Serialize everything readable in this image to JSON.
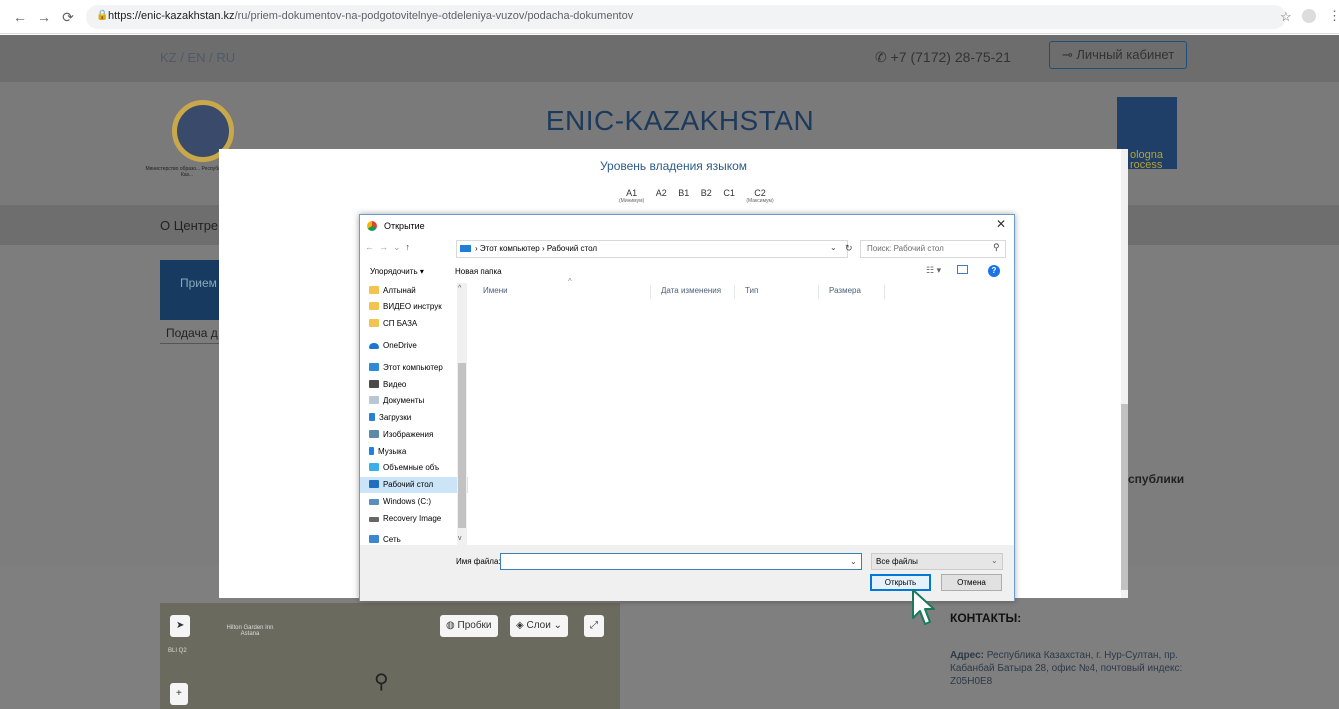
{
  "browser": {
    "url_host": "https://enic-kazakhstan.kz",
    "url_path": "/ru/priem-dokumentov-na-podgotovitelnye-otdeleniya-vuzov/podacha-dokumentov"
  },
  "site": {
    "languages": "KZ / EN / RU",
    "phone": "+7 (7172) 28-75-21",
    "cabinet_button": "Личный кабинет",
    "title": "ENIC-KAZAKHSTAN",
    "bologna_text": "ologna\nrocess",
    "logo_caption": "Министерство образо... Республики Каз...",
    "menu_about": "О Центре",
    "tab_priem": "Прием",
    "tab_podacha": "Подача д",
    "right_text": "спублики",
    "contacts_title": "КОНТАКТЫ:",
    "contacts_address_label": "Адрес:",
    "contacts_address": "Республика Казахстан, г. Нур-Султан, пр. Кабанбай Батыра 28, офис №4, почтовый индекс: Z05H0E8",
    "map": {
      "traffic": "Пробки",
      "layers": "Слои",
      "place": "Hilton Garden Inn Astana",
      "label_left": "BLI Q2"
    }
  },
  "modal": {
    "heading": "Уровень владения языком",
    "levels": [
      {
        "code": "A1",
        "note": "(Минимум)"
      },
      {
        "code": "A2",
        "note": ""
      },
      {
        "code": "B1",
        "note": ""
      },
      {
        "code": "B2",
        "note": ""
      },
      {
        "code": "C1",
        "note": ""
      },
      {
        "code": "C2",
        "note": "(Максимум)"
      }
    ]
  },
  "dialog": {
    "title": "Открытие",
    "path": [
      "Этот компьютер",
      "Рабочий стол"
    ],
    "search_placeholder": "Поиск: Рабочий стол",
    "organize": "Упорядочить ▾",
    "new_folder": "Новая папка",
    "nav_items": [
      {
        "label": "Алтынай",
        "icon": "folder-icon",
        "kind": "folder"
      },
      {
        "label": "ВИДЕО инструк",
        "icon": "folder-icon",
        "kind": "folder"
      },
      {
        "label": "СП БАЗА",
        "icon": "folder-icon",
        "kind": "folder"
      },
      {
        "label": "OneDrive",
        "icon": "onedrive-icon",
        "kind": "cloud"
      },
      {
        "label": "Этот компьютер",
        "icon": "computer-icon",
        "kind": "pc"
      },
      {
        "label": "Видео",
        "icon": "video-icon",
        "kind": "vid"
      },
      {
        "label": "Документы",
        "icon": "documents-icon",
        "kind": "doc"
      },
      {
        "label": "Загрузки",
        "icon": "downloads-icon",
        "kind": "dl"
      },
      {
        "label": "Изображения",
        "icon": "images-icon",
        "kind": "img"
      },
      {
        "label": "Музыка",
        "icon": "music-icon",
        "kind": "mus"
      },
      {
        "label": "Объемные объ",
        "icon": "3d-objects-icon",
        "kind": "obj"
      },
      {
        "label": "Рабочий стол",
        "icon": "desktop-icon",
        "kind": "desk",
        "selected": true
      },
      {
        "label": "Windows (C:)",
        "icon": "drive-icon",
        "kind": "drive"
      },
      {
        "label": "Recovery Image",
        "icon": "recovery-drive-icon",
        "kind": "rec"
      },
      {
        "label": "Сеть",
        "icon": "network-icon",
        "kind": "net"
      }
    ],
    "columns": [
      "Имени",
      "Дата изменения",
      "Тип",
      "Размера"
    ],
    "filename_label": "Имя файла:",
    "filename_value": "",
    "filter": "Все файлы",
    "open_button": "Открыть",
    "cancel_button": "Отмена"
  },
  "colors": {
    "modal_heading": "#2c5c8a",
    "site_title": "#1c3a5c",
    "dialog_border": "#6c9bd2",
    "selected_nav": "#cce4f7",
    "primary_button_border": "#0078d7"
  }
}
